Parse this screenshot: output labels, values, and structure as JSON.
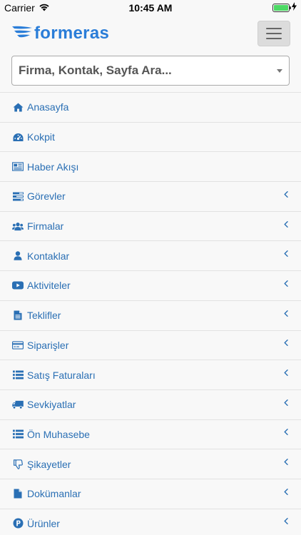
{
  "status_bar": {
    "carrier": "Carrier",
    "time": "10:45 AM",
    "battery_level": 1.0
  },
  "header": {
    "logo_text": "formeras"
  },
  "search": {
    "placeholder": "Firma, Kontak, Sayfa Ara..."
  },
  "colors": {
    "accent": "#2a6fb4",
    "logo": "#2a7dd8",
    "battery": "#4cd964"
  },
  "menu": [
    {
      "label": "Anasayfa",
      "icon": "home-icon",
      "submenu": false
    },
    {
      "label": "Kokpit",
      "icon": "dashboard-icon",
      "submenu": false
    },
    {
      "label": "Haber Akışı",
      "icon": "newspaper-icon",
      "submenu": false
    },
    {
      "label": "Görevler",
      "icon": "tasks-icon",
      "submenu": true
    },
    {
      "label": "Firmalar",
      "icon": "users-icon",
      "submenu": true
    },
    {
      "label": "Kontaklar",
      "icon": "user-icon",
      "submenu": true
    },
    {
      "label": "Aktiviteler",
      "icon": "youtube-icon",
      "submenu": true
    },
    {
      "label": "Teklifler",
      "icon": "file-text-icon",
      "submenu": true
    },
    {
      "label": "Siparişler",
      "icon": "credit-card-icon",
      "submenu": true
    },
    {
      "label": "Satış Faturaları",
      "icon": "list-icon",
      "submenu": true
    },
    {
      "label": "Sevkiyatlar",
      "icon": "truck-icon",
      "submenu": true
    },
    {
      "label": "Ön Muhasebe",
      "icon": "list-icon",
      "submenu": true
    },
    {
      "label": "Şikayetler",
      "icon": "thumbs-down-icon",
      "submenu": true
    },
    {
      "label": "Dokümanlar",
      "icon": "file-icon",
      "submenu": true
    },
    {
      "label": "Ürünler",
      "icon": "product-p-icon",
      "submenu": true
    }
  ]
}
